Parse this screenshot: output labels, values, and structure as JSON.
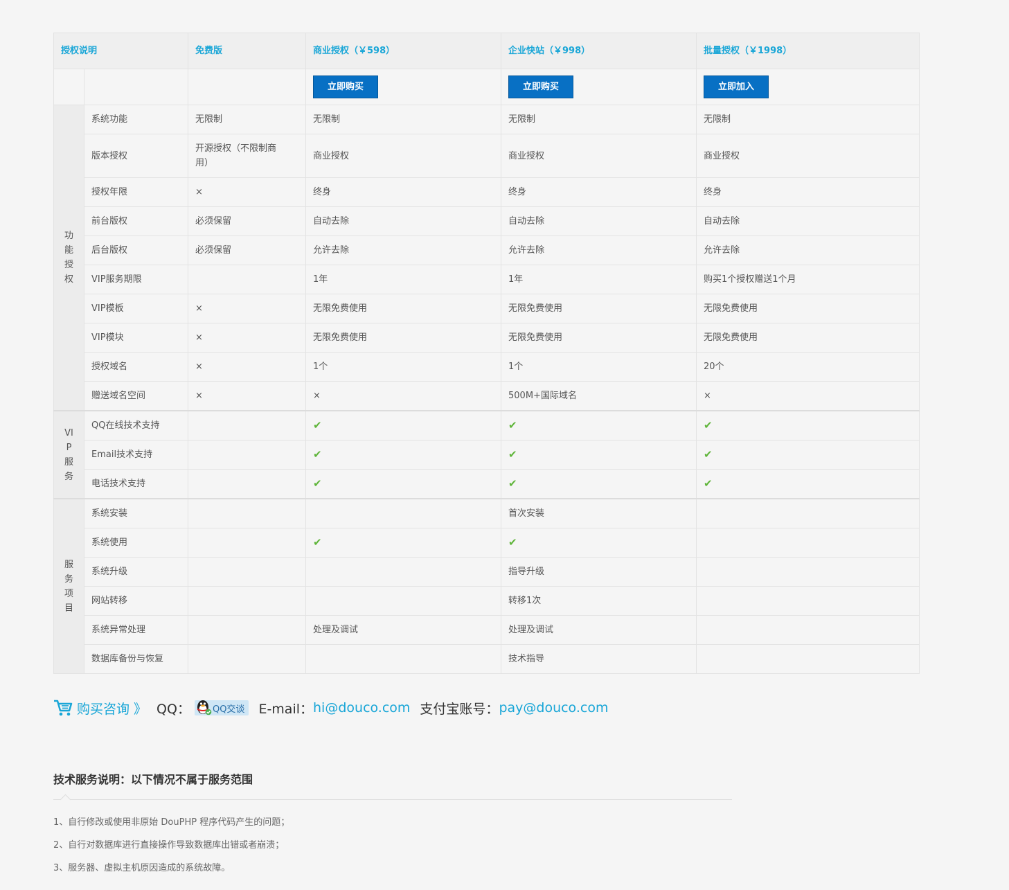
{
  "header": {
    "col0": "授权说明",
    "col1": "免费版",
    "col2": "商业授权（￥598）",
    "col3": "企业快站（￥998）",
    "col4": "批量授权（￥1998）"
  },
  "buttons": {
    "commercial": "立即购买",
    "enterprise": "立即购买",
    "bulk": "立即加入"
  },
  "groups": {
    "feature": "功能授权",
    "vip": "VIP服务",
    "service": "服务项目"
  },
  "feature_rows": [
    {
      "label": "系统功能",
      "free": "无限制",
      "commercial": "无限制",
      "enterprise": "无限制",
      "bulk": "无限制"
    },
    {
      "label": "版本授权",
      "free": "开源授权（不限制商用）",
      "commercial": "商业授权",
      "enterprise": "商业授权",
      "bulk": "商业授权"
    },
    {
      "label": "授权年限",
      "free": "×",
      "commercial": "终身",
      "enterprise": "终身",
      "bulk": "终身"
    },
    {
      "label": "前台版权",
      "free": "必须保留",
      "commercial": "自动去除",
      "enterprise": "自动去除",
      "bulk": "自动去除"
    },
    {
      "label": "后台版权",
      "free": "必须保留",
      "commercial": "允许去除",
      "enterprise": "允许去除",
      "bulk": "允许去除"
    },
    {
      "label": "VIP服务期限",
      "free": "",
      "commercial": "1年",
      "enterprise": "1年",
      "bulk": "购买1个授权赠送1个月"
    },
    {
      "label": "VIP模板",
      "free": "×",
      "commercial": "无限免费使用",
      "enterprise": "无限免费使用",
      "bulk": "无限免费使用"
    },
    {
      "label": "VIP模块",
      "free": "×",
      "commercial": "无限免费使用",
      "enterprise": "无限免费使用",
      "bulk": "无限免费使用"
    },
    {
      "label": "授权域名",
      "free": "×",
      "commercial": "1个",
      "enterprise": "1个",
      "bulk": "20个"
    },
    {
      "label": "赠送域名空间",
      "free": "×",
      "commercial": "×",
      "enterprise": "500M+国际域名",
      "bulk": "×"
    }
  ],
  "vip_rows": [
    {
      "label": "QQ在线技术支持",
      "free": "",
      "commercial": "✔",
      "enterprise": "✔",
      "bulk": "✔"
    },
    {
      "label": "Email技术支持",
      "free": "",
      "commercial": "✔",
      "enterprise": "✔",
      "bulk": "✔"
    },
    {
      "label": "电话技术支持",
      "free": "",
      "commercial": "✔",
      "enterprise": "✔",
      "bulk": "✔"
    }
  ],
  "service_rows": [
    {
      "label": "系统安装",
      "free": "",
      "commercial": "",
      "enterprise": "首次安装",
      "bulk": ""
    },
    {
      "label": "系统使用",
      "free": "",
      "commercial": "✔",
      "enterprise": "✔",
      "bulk": ""
    },
    {
      "label": "系统升级",
      "free": "",
      "commercial": "",
      "enterprise": "指导升级",
      "bulk": ""
    },
    {
      "label": "网站转移",
      "free": "",
      "commercial": "",
      "enterprise": "转移1次",
      "bulk": ""
    },
    {
      "label": "系统异常处理",
      "free": "",
      "commercial": "处理及调试",
      "enterprise": "处理及调试",
      "bulk": ""
    },
    {
      "label": "数据库备份与恢复",
      "free": "",
      "commercial": "",
      "enterprise": "技术指导",
      "bulk": ""
    }
  ],
  "contact": {
    "consult": "购买咨询 》",
    "qq_label": "QQ：",
    "qq_badge": "QQ交谈",
    "email_label": "E-mail：",
    "email": "hi@douco.com",
    "alipay_label": "支付宝账号：",
    "alipay": "pay@douco.com"
  },
  "notes": {
    "title": "技术服务说明：以下情况不属于服务范围",
    "items": [
      "1、自行修改或使用非原始 DouPHP 程序代码产生的问题；",
      "2、自行对数据库进行直接操作导致数据库出错或者崩溃；",
      "3、服务器、虚拟主机原因造成的系统故障。"
    ]
  }
}
